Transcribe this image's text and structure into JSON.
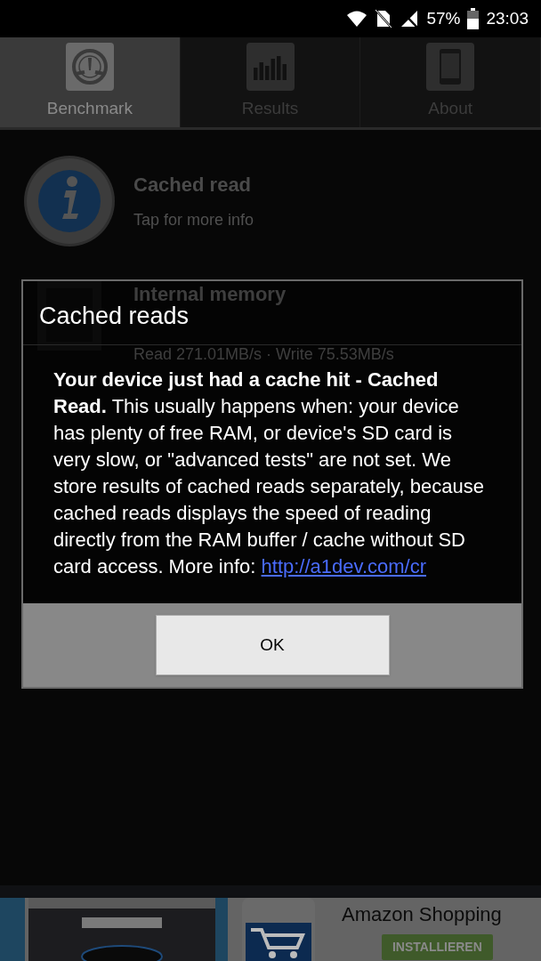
{
  "status_bar": {
    "battery": "57%",
    "time": "23:03"
  },
  "tabs": [
    {
      "label": "Benchmark",
      "selected": true,
      "kind": "gauge"
    },
    {
      "label": "Results",
      "selected": false,
      "kind": "bars"
    },
    {
      "label": "About",
      "selected": false,
      "kind": "phone"
    }
  ],
  "list": [
    {
      "title": "Cached read",
      "subtitle": "Tap for more info",
      "kind": "info"
    },
    {
      "title": "Internal memory",
      "subtitle": "Read 271.01MB/s · Write 75.53MB/s",
      "kind": "memory"
    }
  ],
  "dialog": {
    "title": "Cached reads",
    "message": "**Your device just had a cache hit - Cached Read.** This usually happens when: your device has plenty of free RAM, or device's SD card is very slow, or \"advanced tests\" are not set. We store results of cached reads separately, because cached reads displays the speed of reading directly from the RAM buffer / cache without SD card access. More info:",
    "link": "http://a1dev.com/cr",
    "buttons": [
      "OK"
    ]
  },
  "ad": {
    "title": "Amazon Shopping",
    "button": "INSTALLIEREN"
  }
}
